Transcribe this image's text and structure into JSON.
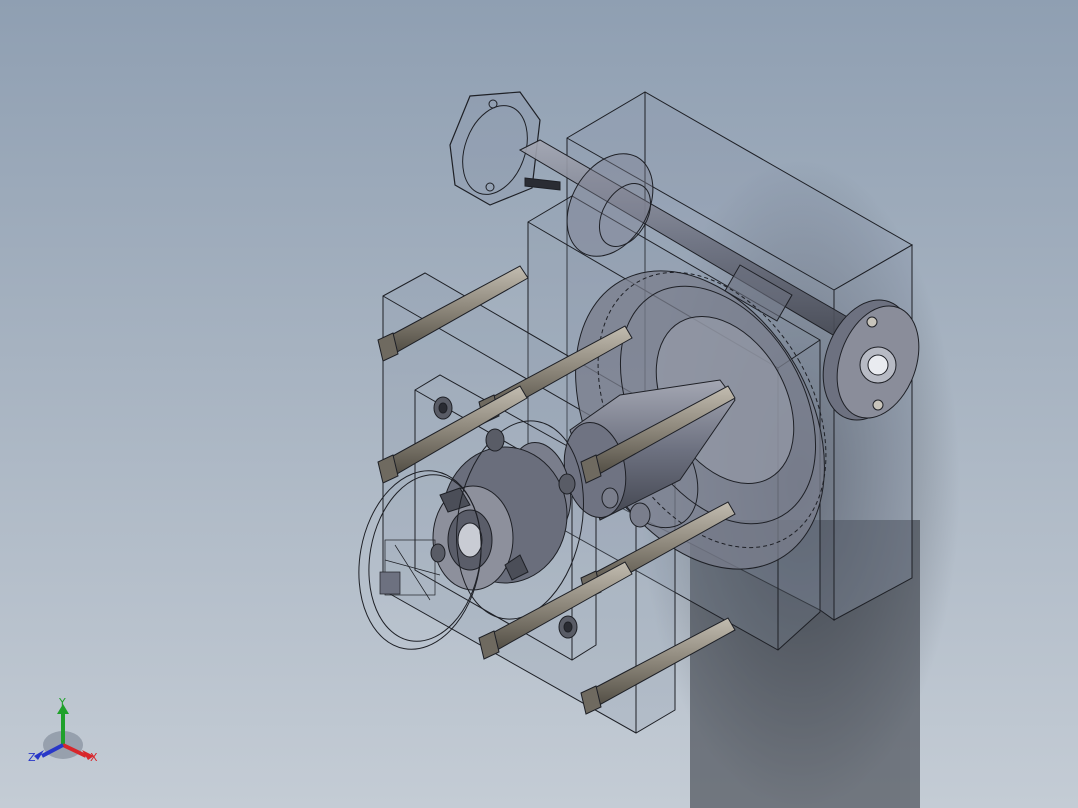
{
  "viewport": {
    "background_top": "#8f9fb2",
    "background_bottom": "#c4ccd5"
  },
  "model": {
    "line_color": "#1e2026",
    "part_fill": "#6d7180",
    "bolt_fill": "#8a8478",
    "transparent_fill": "#8a94a8"
  },
  "triad": {
    "x_label": "X",
    "y_label": "Y",
    "z_label": "Z",
    "x_color": "#d8262b",
    "y_color": "#1fa12b",
    "z_color": "#2837c8"
  }
}
